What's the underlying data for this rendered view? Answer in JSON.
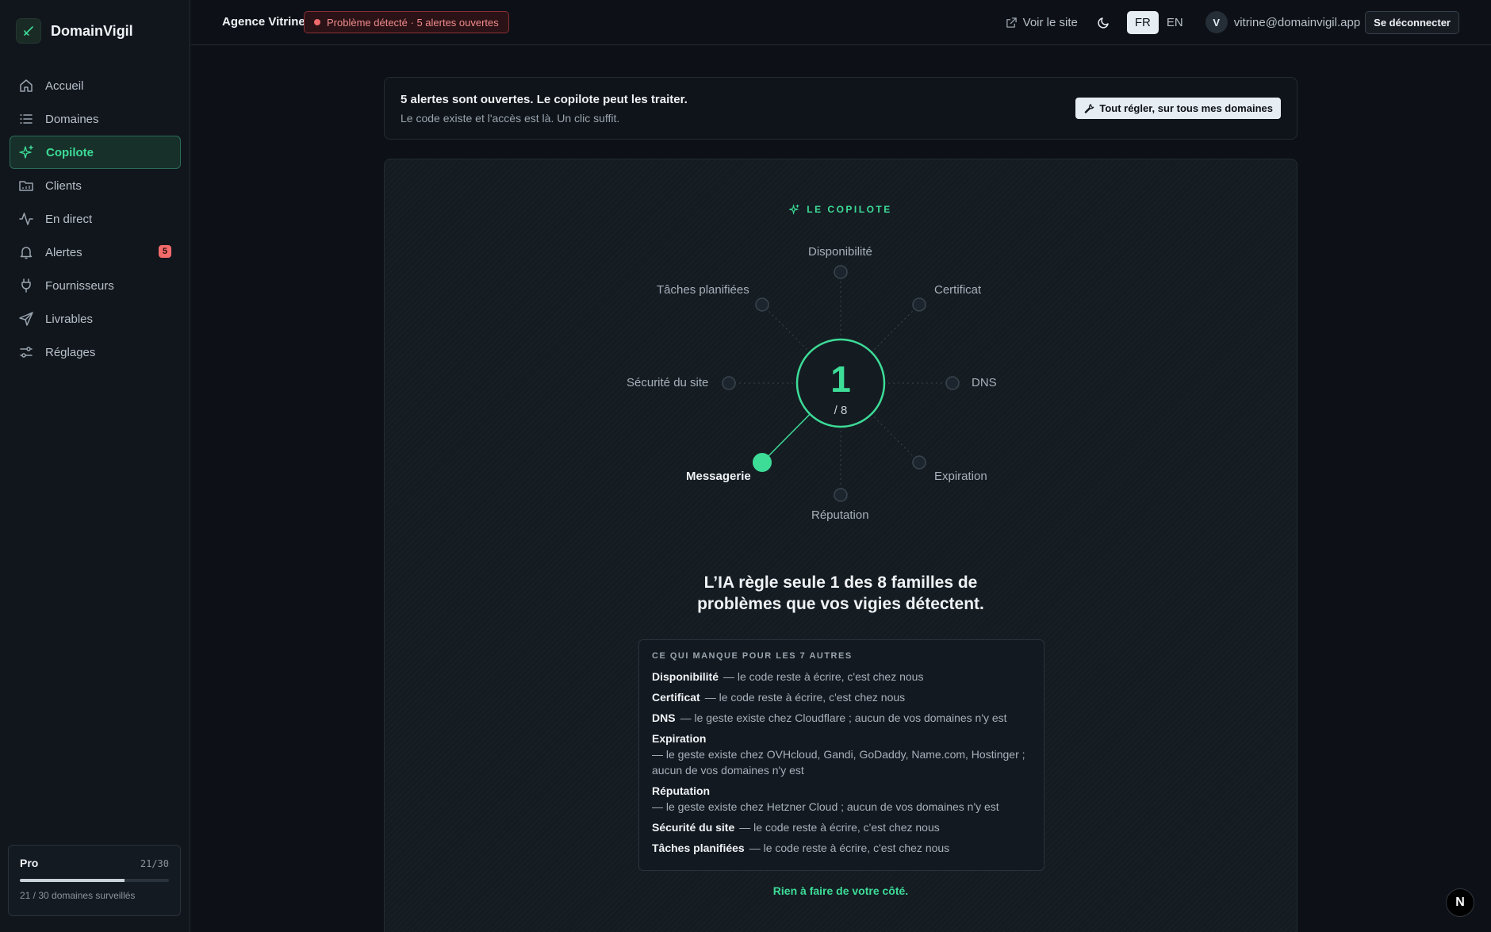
{
  "brand": {
    "name": "DomainVigil"
  },
  "sidebar": {
    "items": [
      {
        "label": "Accueil",
        "icon": "home-icon"
      },
      {
        "label": "Domaines",
        "icon": "list-icon"
      },
      {
        "label": "Copilote",
        "icon": "sparkles-icon",
        "active": true
      },
      {
        "label": "Clients",
        "icon": "folder-icon"
      },
      {
        "label": "En direct",
        "icon": "activity-icon"
      },
      {
        "label": "Alertes",
        "icon": "bell-icon",
        "badge": "5"
      },
      {
        "label": "Fournisseurs",
        "icon": "plug-icon"
      },
      {
        "label": "Livrables",
        "icon": "send-icon"
      },
      {
        "label": "Réglages",
        "icon": "sliders-icon"
      }
    ],
    "plan": {
      "name": "Pro",
      "count": "21/30",
      "note": "21 / 30 domaines surveillés",
      "fill_fraction": 0.7
    }
  },
  "header": {
    "agency": "Agence Vitrine",
    "alert_pill": "Problème détecté · 5 alertes ouvertes",
    "view_site": "Voir le site",
    "lang_fr": "FR",
    "lang_en": "EN",
    "avatar_initial": "V",
    "email": "vitrine@domainvigil.app",
    "logout": "Se déconnecter"
  },
  "banner": {
    "title": "5 alertes sont ouvertes. Le copilote peut les traiter.",
    "subtitle": "Le code existe et l'accès est là. Un clic suffit.",
    "button": "Tout régler, sur tous mes domaines"
  },
  "copilot": {
    "label": "LE COPILOTE",
    "center_value": "1",
    "center_total": "/ 8",
    "families": {
      "disponibilite": "Disponibilité",
      "certificat": "Certificat",
      "dns": "DNS",
      "expiration": "Expiration",
      "reputation": "Réputation",
      "messagerie": "Messagerie",
      "securite": "Sécurité du site",
      "taches": "Tâches planifiées"
    },
    "handled": "Messagerie",
    "headline_line1": "L’IA règle seule 1 des 8 familles de",
    "headline_line2": "problèmes que vos vigies détectent.",
    "missing_title": "CE QUI MANQUE POUR LES 7 AUTRES",
    "missing": [
      {
        "name": "Disponibilité",
        "text": "— le code reste à écrire, c'est chez nous"
      },
      {
        "name": "Certificat",
        "text": "— le code reste à écrire, c'est chez nous"
      },
      {
        "name": "DNS",
        "text": "— le geste existe chez Cloudflare ; aucun de vos domaines n'y est"
      },
      {
        "name": "Expiration",
        "text": "— le geste existe chez OVHcloud, Gandi, GoDaddy, Name.com, Hostinger ; aucun de vos domaines n'y est"
      },
      {
        "name": "Réputation",
        "text": "— le geste existe chez Hetzner Cloud ; aucun de vos domaines n'y est"
      },
      {
        "name": "Sécurité du site",
        "text": "— le code reste à écrire, c'est chez nous"
      },
      {
        "name": "Tâches planifiées",
        "text": "— le code reste à écrire, c'est chez nous"
      }
    ],
    "nothing_to_do": "Rien à faire de votre côté."
  },
  "colors": {
    "accent": "#3ddc97",
    "danger": "#f06b6b",
    "background": "#0d1117"
  },
  "fab_label": "N"
}
